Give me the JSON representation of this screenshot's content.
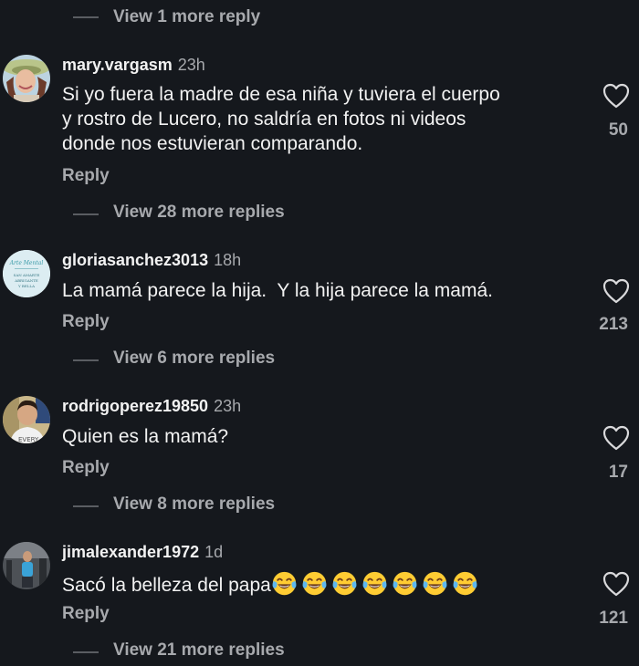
{
  "top_thread": {
    "view_more_label": "View 1 more reply"
  },
  "comments": [
    {
      "username": "mary.vargasm",
      "timestamp": "23h",
      "text_lines": [
        "Si yo fuera la madre de esa niña y tuviera el cuerpo",
        "y rostro de Lucero, no saldría en fotos ni videos",
        "donde nos estuvieran comparando."
      ],
      "reply_label": "Reply",
      "likes": "50",
      "view_more_label": "View 28 more replies",
      "avatar_icon": "woman-hat-avatar"
    },
    {
      "username": "gloriasanchez3013",
      "timestamp": "18h",
      "text": "La mamá parece la hija.  Y la hija parece la mamá.",
      "reply_label": "Reply",
      "likes": "213",
      "view_more_label": "View 6 more replies",
      "avatar_icon": "text-logo-avatar",
      "avatar_text": [
        "Arte Mental",
        "SAN AMARTE",
        "ABRIGANTE",
        "Y BELLA"
      ]
    },
    {
      "username": "rodrigoperez19850",
      "timestamp": "23h",
      "text": "Quien es la mamá?",
      "reply_label": "Reply",
      "likes": "17",
      "view_more_label": "View 8 more replies",
      "avatar_icon": "young-man-avatar",
      "avatar_text": "EVERY"
    },
    {
      "username": "jimalexander1972",
      "timestamp": "1d",
      "text": "Sacó la belleza del papa",
      "emoji_count": 7,
      "emoji_icon": "tears-of-joy-emoji",
      "reply_label": "Reply",
      "likes": "121",
      "view_more_label": "View 21 more replies",
      "avatar_icon": "gym-man-avatar"
    }
  ],
  "colors": {
    "background": "#15181d",
    "primary_text": "#f2f2f2",
    "secondary_text": "#a7a9ad",
    "thread_line": "#5a5d62"
  }
}
